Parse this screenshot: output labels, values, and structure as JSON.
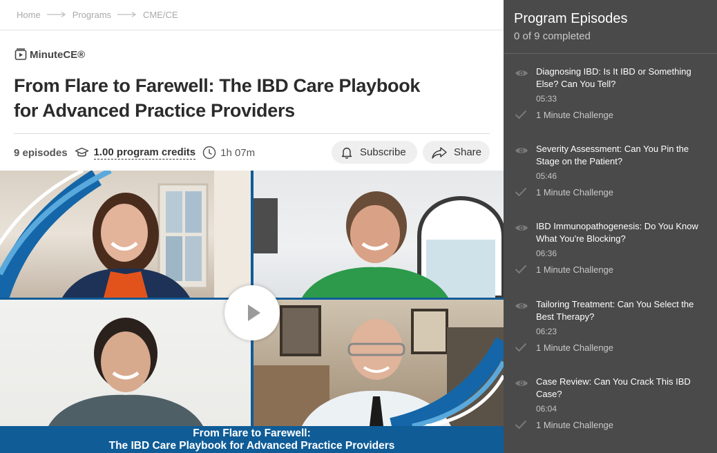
{
  "breadcrumb": [
    "Home",
    "Programs",
    "CME/CE"
  ],
  "brand": {
    "name": "MinuteCE®",
    "icon": "play-box-icon"
  },
  "program": {
    "title_lines": [
      "From Flare to Farewell: The IBD Care Playbook",
      "for Advanced Practice Providers"
    ],
    "episodes_label": "9 episodes",
    "credits_label": "1.00 program credits",
    "duration": "1h 07m",
    "subscribe_label": "Subscribe",
    "share_label": "Share"
  },
  "video": {
    "caption_lines": [
      "From Flare to Farewell:",
      "The IBD Care Playbook for Advanced Practice Providers"
    ],
    "accent": "#0f5c97"
  },
  "panel": {
    "title": "Program Episodes",
    "progress": "0 of 9 completed",
    "episodes": [
      {
        "title": "Diagnosing IBD: Is It IBD or Something Else? Can You Tell?",
        "duration": "05:33",
        "challenge": "1 Minute Challenge"
      },
      {
        "title": "Severity Assessment: Can You Pin the Stage on the Patient?",
        "duration": "05:46",
        "challenge": "1 Minute Challenge"
      },
      {
        "title": "IBD Immunopathogenesis: Do You Know What You're Blocking?",
        "duration": "06:36",
        "challenge": "1 Minute Challenge"
      },
      {
        "title": "Tailoring Treatment: Can You Select the Best Therapy?",
        "duration": "06:23",
        "challenge": "1 Minute Challenge"
      },
      {
        "title": "Case Review: Can You Crack This IBD Case?",
        "duration": "06:04",
        "challenge": "1 Minute Challenge"
      }
    ]
  },
  "colors": {
    "panel_bg": "#4a4a4a",
    "pill_bg": "#efefef",
    "caption_bg": "#0f5c97"
  }
}
